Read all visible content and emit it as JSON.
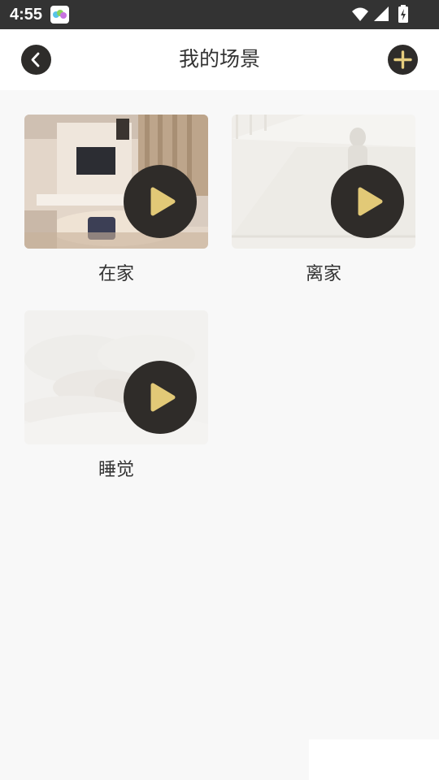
{
  "status_bar": {
    "time": "4:55",
    "icons": [
      "app-notification-icon",
      "wifi-icon",
      "cellular-signal-icon",
      "battery-charging-icon"
    ]
  },
  "header": {
    "title": "我的场景",
    "back_icon": "chevron-left-icon",
    "add_icon": "plus-icon"
  },
  "scenes": [
    {
      "label": "在家",
      "image": "living-room-photo",
      "active": true
    },
    {
      "label": "离家",
      "image": "hallway-photo",
      "active": false
    },
    {
      "label": "睡觉",
      "image": "sleeping-photo",
      "active": false
    }
  ],
  "colors": {
    "status_bar": "#333333",
    "header_bg": "#ffffff",
    "page_bg": "#f8f8f8",
    "button_dark": "#2e2c2a",
    "accent_gold": "#e6cd7e",
    "text": "#333333"
  }
}
